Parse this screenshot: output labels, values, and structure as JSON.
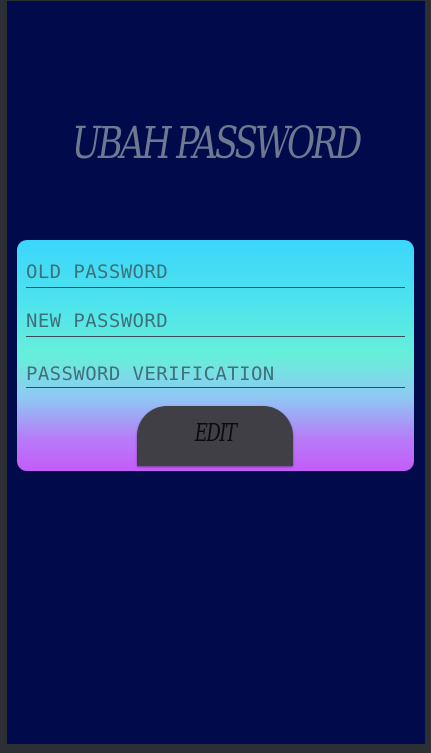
{
  "header": {
    "title": "UBAH PASSWORD"
  },
  "form": {
    "old_password_placeholder": "OLD PASSWORD",
    "new_password_placeholder": "NEW PASSWORD",
    "verification_placeholder": "PASSWORD VERIFICATION",
    "edit_label": "EDIT"
  },
  "colors": {
    "background": "#010a4a",
    "card_gradient_top": "#3cd6fb",
    "card_gradient_mid": "#66efd9",
    "card_gradient_bottom": "#c45cfa",
    "button": "#3f3f45"
  }
}
